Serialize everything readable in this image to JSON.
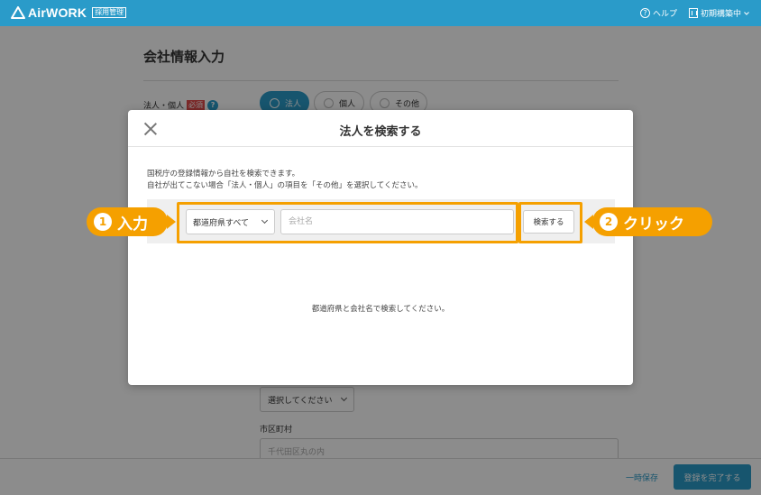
{
  "header": {
    "logo_text": "AirWORK",
    "logo_badge": "採用管理",
    "help_label": "ヘルプ",
    "user_label": "初期構築中"
  },
  "page": {
    "title": "会社情報入力",
    "field_label": "法人・個人",
    "required_badge": "必須",
    "radio_options": [
      "法人",
      "個人",
      "その他"
    ],
    "prefecture_select": "選択してください",
    "city_label": "市区町村",
    "city_placeholder": "千代田区丸の内"
  },
  "footer": {
    "save_label": "一時保存",
    "submit_label": "登録を完了する"
  },
  "modal": {
    "title": "法人を検索する",
    "description_line1": "国税庁の登録情報から自社を検索できます。",
    "description_line2": "自社が出てこない場合「法人・個人」の項目を「その他」を選択してください。",
    "prefecture_dropdown": "都道府県すべて",
    "company_placeholder": "会社名",
    "search_button": "検索する",
    "empty_message": "都道府県と会社名で検索してください。"
  },
  "annotations": {
    "step1_num": "1",
    "step1_label": "入力",
    "step2_num": "2",
    "step2_label": "クリック",
    "accent_color": "#f5a000"
  },
  "colors": {
    "brand": "#2a9bc9",
    "required": "#e04b4b"
  }
}
